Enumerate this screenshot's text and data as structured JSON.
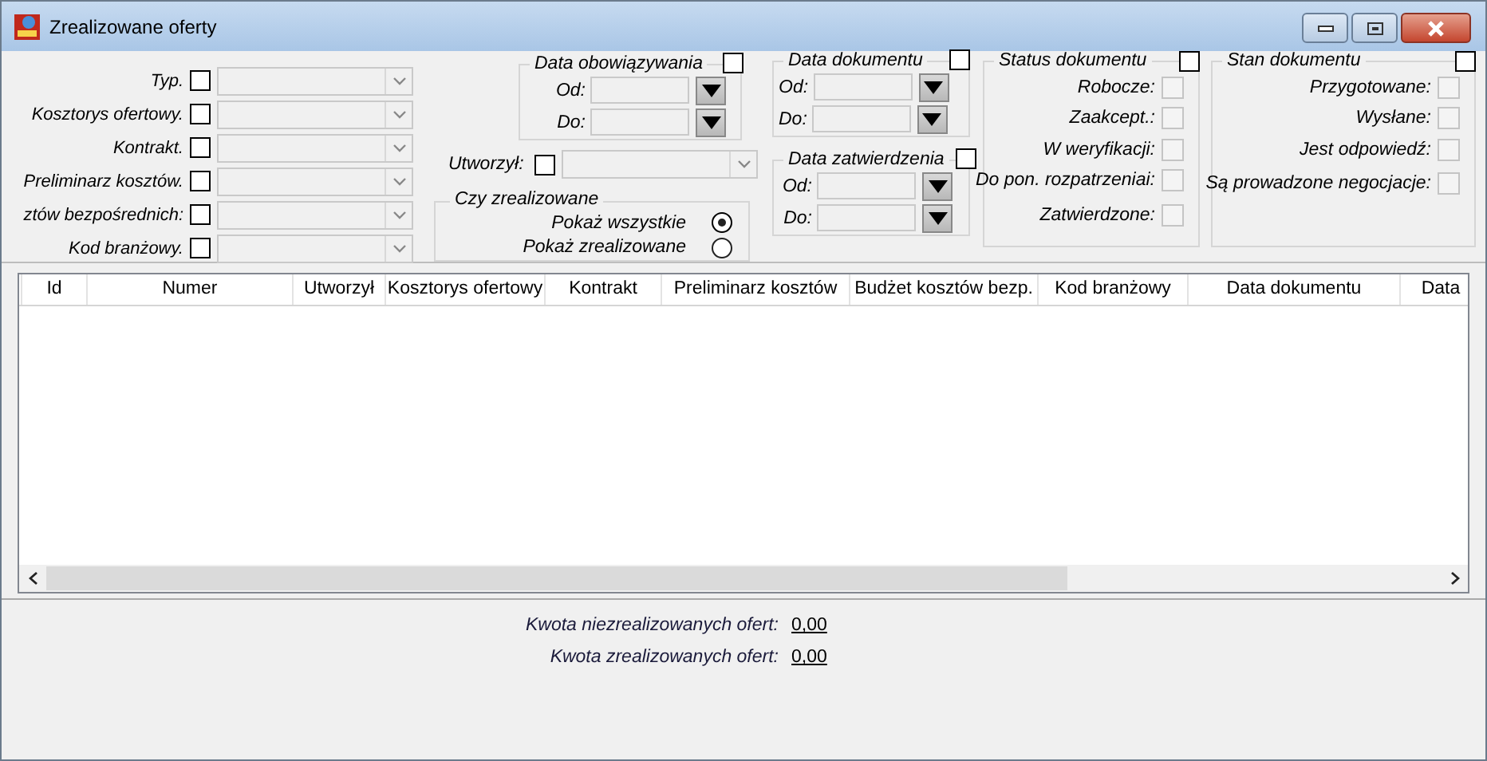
{
  "window": {
    "title": "Zrealizowane oferty"
  },
  "filters": [
    {
      "label": "Typ.",
      "checked": false
    },
    {
      "label": "Kosztorys ofertowy.",
      "checked": false
    },
    {
      "label": "Kontrakt.",
      "checked": false
    },
    {
      "label": "Preliminarz kosztów.",
      "checked": false
    },
    {
      "label": "ztów bezpośrednich:",
      "checked": false
    },
    {
      "label": "Kod branżowy.",
      "checked": false
    }
  ],
  "validity_date": {
    "title": "Data obowiązywania",
    "checked": false,
    "from_label": "Od:",
    "to_label": "Do:"
  },
  "created_by": {
    "label": "Utworzył:",
    "checked": false
  },
  "realized": {
    "title": "Czy zrealizowane",
    "options": [
      {
        "label": "Pokaż wszystkie",
        "selected": true
      },
      {
        "label": "Pokaż zrealizowane",
        "selected": false
      }
    ]
  },
  "document_date": {
    "title": "Data dokumentu",
    "checked": false,
    "from_label": "Od:",
    "to_label": "Do:"
  },
  "approval_date": {
    "title": "Data zatwierdzenia",
    "checked": false,
    "from_label": "Od:",
    "to_label": "Do:"
  },
  "document_status": {
    "title": "Status dokumentu",
    "checked": false,
    "items": [
      {
        "label": "Robocze:",
        "checked": false,
        "disabled": true
      },
      {
        "label": "Zaakcept.:",
        "checked": false,
        "disabled": true
      },
      {
        "label": "W weryfikacji:",
        "checked": false,
        "disabled": true
      },
      {
        "label": "Do pon. rozpatrzeniai:",
        "checked": false,
        "disabled": true
      },
      {
        "label": "Zatwierdzone:",
        "checked": false,
        "disabled": true
      }
    ]
  },
  "document_state": {
    "title": "Stan dokumentu",
    "checked": false,
    "items": [
      {
        "label": "Przygotowane:",
        "checked": false,
        "disabled": true
      },
      {
        "label": "Wysłane:",
        "checked": false,
        "disabled": true
      },
      {
        "label": "Jest odpowiedź:",
        "checked": false,
        "disabled": true
      },
      {
        "label": "Są prowadzone negocjacje:",
        "checked": false,
        "disabled": true
      }
    ]
  },
  "table": {
    "columns": [
      "Id",
      "Numer",
      "Utworzył",
      "Kosztorys ofertowy",
      "Kontrakt",
      "Preliminarz kosztów",
      "Budżet kosztów bezp.",
      "Kod branżowy",
      "Data dokumentu",
      "Data"
    ]
  },
  "summary": [
    {
      "label": "Kwota niezrealizowanych ofert:",
      "value": "0,00"
    },
    {
      "label": "Kwota zrealizowanych ofert:",
      "value": "0,00"
    }
  ]
}
